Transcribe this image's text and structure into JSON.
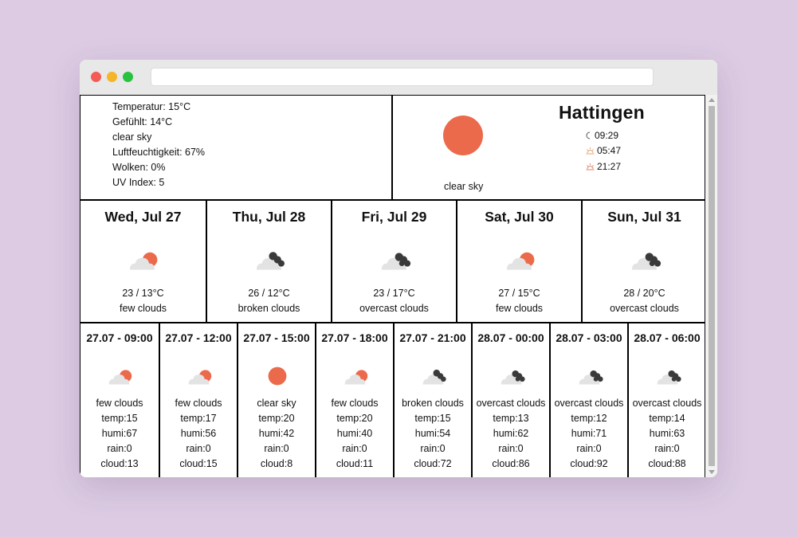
{
  "browser": {
    "url": ""
  },
  "current": {
    "details": [
      "Temperatur: 15°C",
      "Gefühlt: 14°C",
      "clear sky",
      "Luftfeuchtigkeit: 67%",
      "Wolken: 0%",
      "UV Index: 5"
    ],
    "icon": "sun-icon",
    "description": "clear sky",
    "city": "Hattingen",
    "moonrise": "09:29",
    "sunrise": "05:47",
    "sunset": "21:27"
  },
  "daily": [
    {
      "title": "Wed, Jul 27",
      "temp": "23 / 13°C",
      "desc": "few clouds",
      "icon": "few-clouds-icon"
    },
    {
      "title": "Thu, Jul 28",
      "temp": "26 / 12°C",
      "desc": "broken clouds",
      "icon": "broken-clouds-icon"
    },
    {
      "title": "Fri, Jul 29",
      "temp": "23 / 17°C",
      "desc": "overcast clouds",
      "icon": "overcast-clouds-icon"
    },
    {
      "title": "Sat, Jul 30",
      "temp": "27 / 15°C",
      "desc": "few clouds",
      "icon": "few-clouds-icon"
    },
    {
      "title": "Sun, Jul 31",
      "temp": "28 / 20°C",
      "desc": "overcast clouds",
      "icon": "overcast-clouds-icon"
    }
  ],
  "hourly": [
    {
      "title": "27.07 - 09:00",
      "desc": "few clouds",
      "temp": "temp:15",
      "humi": "humi:67",
      "rain": "rain:0",
      "cloud": "cloud:13",
      "icon": "few-clouds-icon"
    },
    {
      "title": "27.07 - 12:00",
      "desc": "few clouds",
      "temp": "temp:17",
      "humi": "humi:56",
      "rain": "rain:0",
      "cloud": "cloud:15",
      "icon": "few-clouds-icon"
    },
    {
      "title": "27.07 - 15:00",
      "desc": "clear sky",
      "temp": "temp:20",
      "humi": "humi:42",
      "rain": "rain:0",
      "cloud": "cloud:8",
      "icon": "sun-icon"
    },
    {
      "title": "27.07 - 18:00",
      "desc": "few clouds",
      "temp": "temp:20",
      "humi": "humi:40",
      "rain": "rain:0",
      "cloud": "cloud:11",
      "icon": "few-clouds-icon"
    },
    {
      "title": "27.07 - 21:00",
      "desc": "broken clouds",
      "temp": "temp:15",
      "humi": "humi:54",
      "rain": "rain:0",
      "cloud": "cloud:72",
      "icon": "broken-clouds-icon"
    },
    {
      "title": "28.07 - 00:00",
      "desc": "overcast clouds",
      "temp": "temp:13",
      "humi": "humi:62",
      "rain": "rain:0",
      "cloud": "cloud:86",
      "icon": "overcast-clouds-icon"
    },
    {
      "title": "28.07 - 03:00",
      "desc": "overcast clouds",
      "temp": "temp:12",
      "humi": "humi:71",
      "rain": "rain:0",
      "cloud": "cloud:92",
      "icon": "overcast-clouds-icon"
    },
    {
      "title": "28.07 - 06:00",
      "desc": "overcast clouds",
      "temp": "temp:14",
      "humi": "humi:63",
      "rain": "rain:0",
      "cloud": "cloud:88",
      "icon": "overcast-clouds-icon"
    }
  ],
  "colors": {
    "background": "#dccbe3",
    "sun": "#ec6a4c",
    "cloud_light": "#e3e3e3",
    "cloud_dark": "#3a3a3a"
  }
}
